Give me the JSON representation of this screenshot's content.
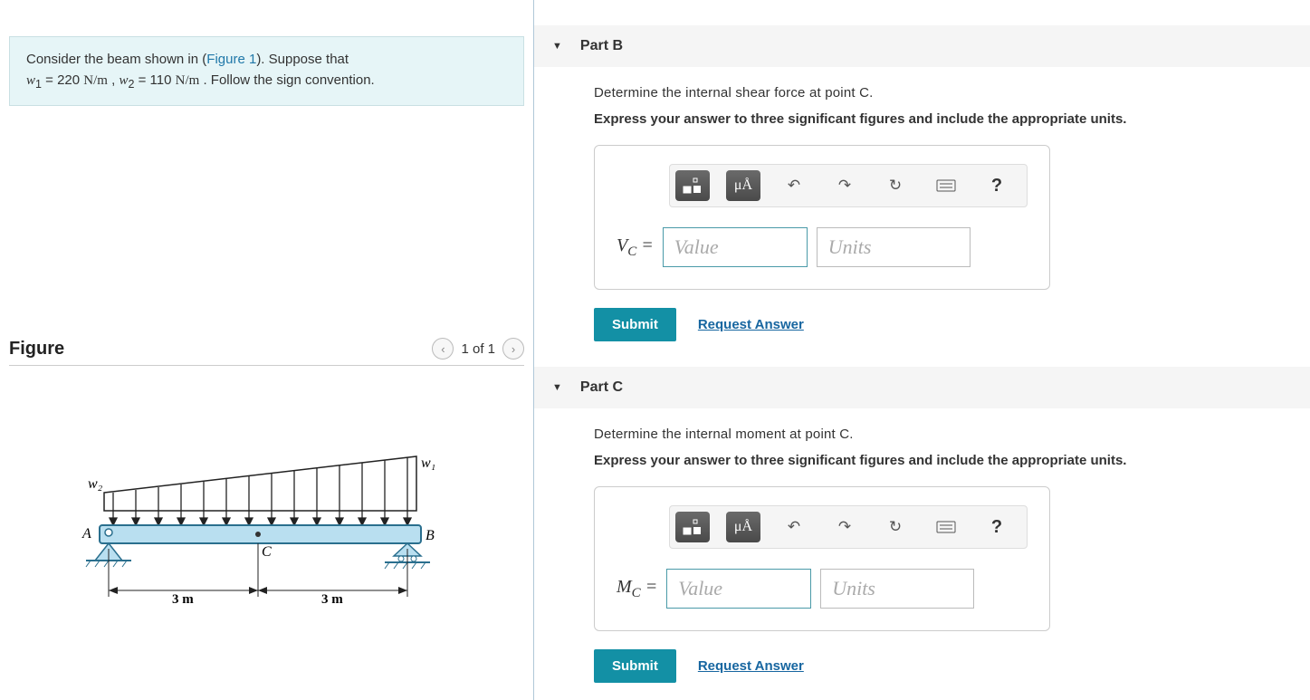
{
  "problem": {
    "intro_before_link": "Consider the beam shown in (",
    "figure_link": "Figure 1",
    "intro_after_link": "). Suppose that ",
    "w1_var": "w",
    "w1_sub": "1",
    "w1_val": " = 220  ",
    "unit_nm": "N/m",
    "sep": " , ",
    "w2_var": "w",
    "w2_sub": "2",
    "w2_val": " = 110  ",
    "tail": " . Follow the sign convention."
  },
  "figure": {
    "title": "Figure",
    "nav": "1 of 1",
    "labels": {
      "w1": "w₁",
      "w2": "w₂",
      "A": "A",
      "B": "B",
      "C": "C",
      "dim": "3 m"
    }
  },
  "toolbar": {
    "units_label": "μÅ",
    "help_label": "?"
  },
  "partB": {
    "title": "Part B",
    "question": "Determine the internal shear force at point C.",
    "instruction": "Express your answer to three significant figures and include the appropriate units.",
    "var_html": "V<sub>C</sub> =",
    "var_base": "V",
    "var_sub": "C",
    "value_placeholder": "Value",
    "units_placeholder": "Units",
    "submit": "Submit",
    "request": "Request Answer"
  },
  "partC": {
    "title": "Part C",
    "question": "Determine the internal moment at point C.",
    "instruction": "Express your answer to three significant figures and include the appropriate units.",
    "var_base": "M",
    "var_sub": "C",
    "value_placeholder": "Value",
    "units_placeholder": "Units",
    "submit": "Submit",
    "request": "Request Answer"
  }
}
